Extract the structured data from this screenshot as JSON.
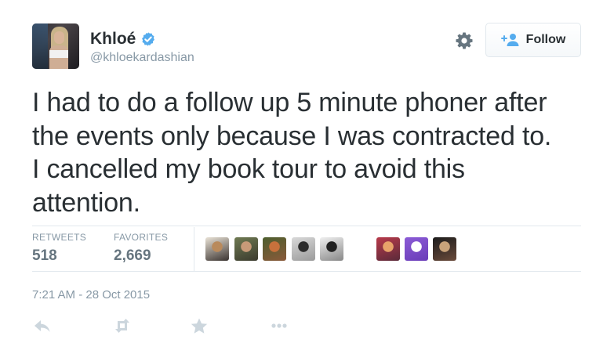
{
  "user": {
    "display_name": "Khloé",
    "handle": "@khloekardashian",
    "verified": true
  },
  "header": {
    "follow_label": "Follow",
    "icons": [
      "gear-icon",
      "verified-badge-icon",
      "follow-person-icon"
    ]
  },
  "tweet": {
    "lines": [
      "I had to do a follow up 5 minute phoner after",
      "the events only because I was contracted to.",
      "I cancelled my book tour to avoid this",
      "attention."
    ]
  },
  "stats": {
    "retweets_label": "RETWEETS",
    "retweets_value": "518",
    "favorites_label": "FAVORITES",
    "favorites_value": "2,669"
  },
  "favoriters": [
    {
      "name": "favoriter-avatar-1",
      "colors": [
        "#e9e2d6",
        "#b98a5c",
        "#3a3330"
      ]
    },
    {
      "name": "favoriter-avatar-2",
      "colors": [
        "#6f7a52",
        "#c79a78",
        "#3b3b2e"
      ]
    },
    {
      "name": "favoriter-avatar-3",
      "colors": [
        "#4d5e2e",
        "#c7713c",
        "#8a5a3a"
      ]
    },
    {
      "name": "favoriter-avatar-4",
      "colors": [
        "#d9d9d9",
        "#2c2c2c",
        "#9a9a9a"
      ]
    },
    {
      "name": "favoriter-avatar-5",
      "colors": [
        "#f0f0f0",
        "#222222",
        "#888888"
      ]
    },
    {
      "name": "favoriter-avatar-6",
      "colors": [
        "#b83a4a",
        "#e8a36a",
        "#5a2a3a"
      ]
    },
    {
      "name": "favoriter-avatar-7",
      "colors": [
        "#8b5bd6",
        "#ffffff",
        "#6a3db8"
      ]
    },
    {
      "name": "favoriter-avatar-8",
      "colors": [
        "#1c1c1c",
        "#c9a37a",
        "#6a4a3a"
      ]
    }
  ],
  "timestamp": "7:21 AM - 28 Oct 2015",
  "actions": [
    "reply-icon",
    "retweet-icon",
    "favorite-star-icon",
    "more-icon"
  ],
  "colors": {
    "text": "#292f33",
    "muted": "#8899a6",
    "stat_value": "#66757f",
    "verified_blue": "#55acee",
    "action_gray": "#ccd6dd",
    "border": "#e1e8ed"
  }
}
